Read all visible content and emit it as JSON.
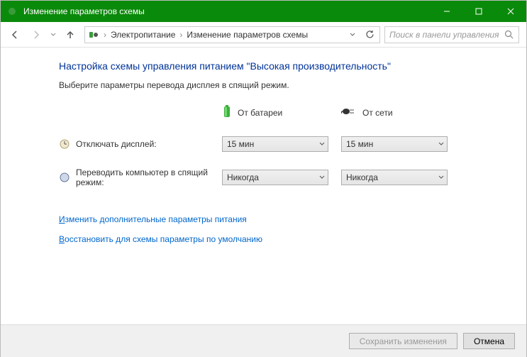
{
  "titlebar": {
    "title": "Изменение параметров схемы"
  },
  "breadcrumb": {
    "item1": "Электропитание",
    "item2": "Изменение параметров схемы"
  },
  "search": {
    "placeholder": "Поиск в панели управления"
  },
  "page": {
    "heading": "Настройка схемы управления питанием \"Высокая производительность\"",
    "subtext": "Выберите параметры перевода дисплея в спящий режим."
  },
  "columns": {
    "battery": "От батареи",
    "plugged": "От сети"
  },
  "rows": {
    "display_off": {
      "label": "Отключать дисплей:",
      "battery": "15 мин",
      "plugged": "15 мин"
    },
    "sleep": {
      "label": "Переводить компьютер в спящий режим:",
      "battery": "Никогда",
      "plugged": "Никогда"
    }
  },
  "links": {
    "advanced_prefix": "И",
    "advanced_rest": "зменить дополнительные параметры питания",
    "restore_prefix": "В",
    "restore_rest": "осстановить для схемы параметры по умолчанию"
  },
  "footer": {
    "save": "Сохранить изменения",
    "cancel": "Отмена"
  }
}
